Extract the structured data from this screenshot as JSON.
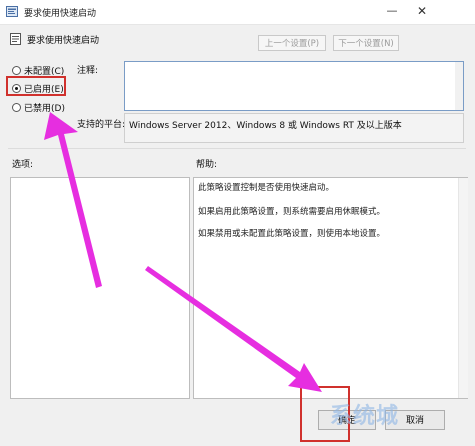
{
  "window": {
    "title": "要求使用快速启动",
    "minimize_glyph": "—",
    "close_glyph": "✕"
  },
  "policy": {
    "name": "要求使用快速启动"
  },
  "nav": {
    "prev_label": "上一个设置(P)",
    "next_label": "下一个设置(N)"
  },
  "state": {
    "options": [
      {
        "label": "未配置(C)",
        "checked": false
      },
      {
        "label": "已启用(E)",
        "checked": true
      },
      {
        "label": "已禁用(D)",
        "checked": false
      }
    ]
  },
  "comment": {
    "label": "注释:",
    "value": ""
  },
  "platform": {
    "label": "支持的平台:",
    "value": "Windows Server 2012、Windows 8 或 Windows RT 及以上版本"
  },
  "options_label": "选项:",
  "help": {
    "label": "帮助:",
    "paragraphs": [
      "此策略设置控制是否使用快速启动。",
      "如果启用此策略设置，则系统需要启用休眠模式。",
      "如果禁用或未配置此策略设置，则使用本地设置。"
    ]
  },
  "footer": {
    "ok_label": "确定",
    "cancel_label": "取消"
  },
  "watermark": "系统城",
  "colors": {
    "highlight_box": "#d0312d",
    "arrow": "#e62ee0",
    "accent_border": "#7a9cc6"
  }
}
